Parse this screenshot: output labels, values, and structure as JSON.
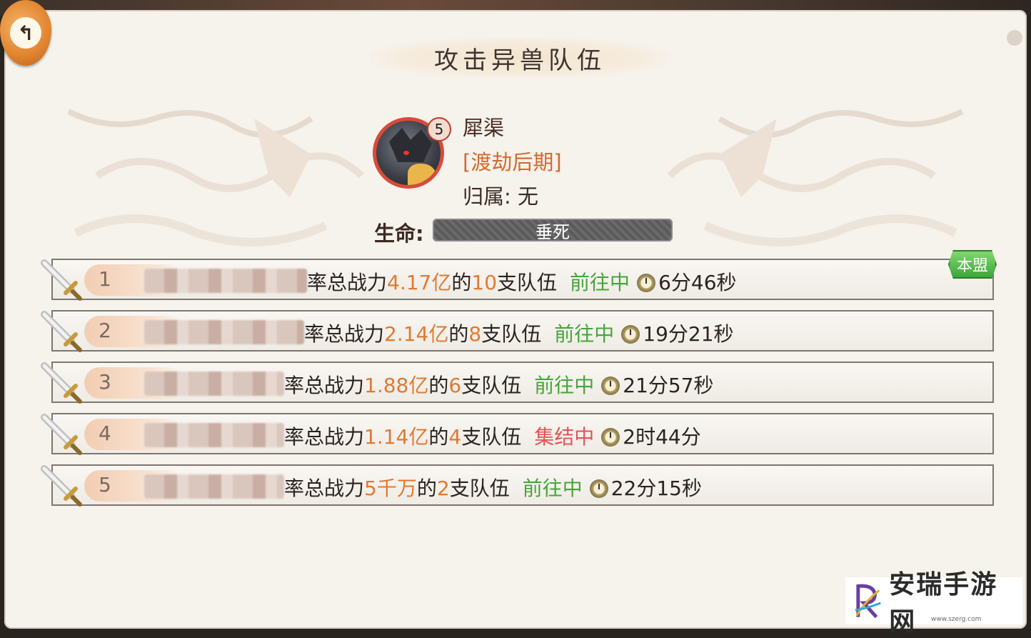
{
  "title": "攻击异兽队伍",
  "beast": {
    "level": "5",
    "name": "犀渠",
    "stage": "[渡劫后期]",
    "owner_label": "归属:",
    "owner_value": "无",
    "hp_label": "生命:",
    "hp_status": "垂死"
  },
  "badge": "本盟",
  "rows": [
    {
      "rank": "1",
      "prefix": "率总战力",
      "power": "4.17亿",
      "mid": "的",
      "count": "10",
      "suffix": "支队伍",
      "status": "前往中",
      "status_type": "go",
      "time": "6分46秒"
    },
    {
      "rank": "2",
      "prefix": "率总战力",
      "power": "2.14亿",
      "mid": "的",
      "count": "8",
      "suffix": "支队伍",
      "status": "前往中",
      "status_type": "go",
      "time": "19分21秒"
    },
    {
      "rank": "3",
      "prefix": "率总战力",
      "power": "1.88亿",
      "mid": "的",
      "count": "6",
      "suffix": "支队伍",
      "status": "前往中",
      "status_type": "go",
      "time": "21分57秒"
    },
    {
      "rank": "4",
      "prefix": "率总战力",
      "power": "1.14亿",
      "mid": "的",
      "count": "4",
      "suffix": "支队伍",
      "status": "集结中",
      "status_type": "gather",
      "time": "2时44分"
    },
    {
      "rank": "5",
      "prefix": "率总战力",
      "power": "5千万",
      "mid": "的",
      "count": "2",
      "suffix": "支队伍",
      "status": "前往中",
      "status_type": "go",
      "time": "22分15秒"
    }
  ],
  "watermark": {
    "text": "安瑞手游网",
    "url": "www.szerg.com"
  },
  "colors": {
    "highlight": "#e07a33",
    "going": "#46a53a",
    "gathering": "#e25555",
    "hp_border": "#d94a3a"
  }
}
